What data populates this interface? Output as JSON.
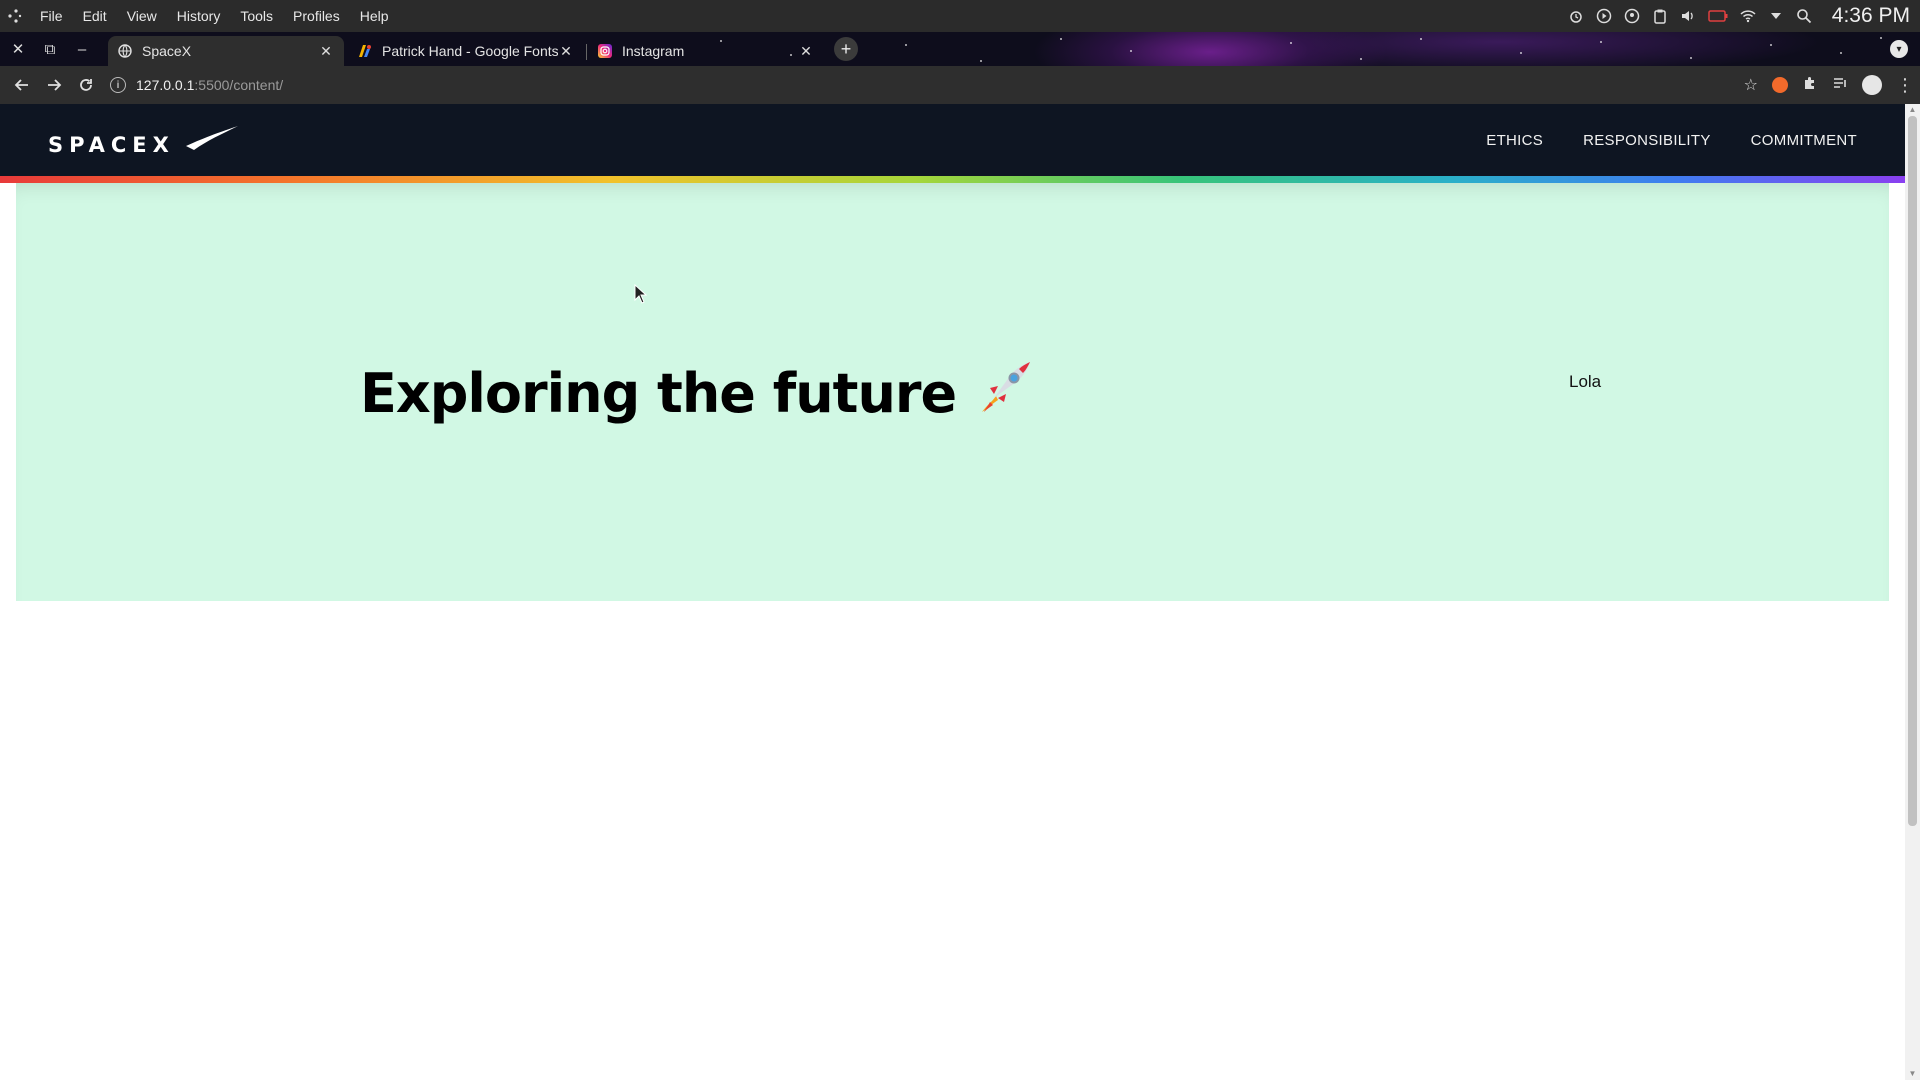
{
  "os_bar": {
    "menu": [
      "File",
      "Edit",
      "View",
      "History",
      "Tools",
      "Profiles",
      "Help"
    ],
    "clock": "4:36 PM",
    "tray_icons": [
      "alarm-icon",
      "play-icon",
      "vpn-icon",
      "clipboard-icon",
      "volume-icon",
      "battery-icon",
      "wifi-icon",
      "dropdown-icon",
      "search-icon"
    ]
  },
  "tabs": [
    {
      "title": "SpaceX",
      "active": true,
      "favicon": "globe-icon"
    },
    {
      "title": "Patrick Hand - Google Fonts",
      "active": false,
      "favicon": "google-fonts-icon"
    },
    {
      "title": "Instagram",
      "active": false,
      "favicon": "instagram-icon"
    }
  ],
  "toolbar": {
    "url_host": "127.0.0.1",
    "url_path": ":5500/content/"
  },
  "site": {
    "logo_text": "SPACEX",
    "nav": [
      "ETHICS",
      "RESPONSIBILITY",
      "COMMITMENT"
    ],
    "hero_title": "Exploring the future",
    "hero_emoji": "🚀",
    "hero_aside": "Lola"
  },
  "colors": {
    "header_bg": "#0e1522",
    "hero_bg": "#d1f8e4",
    "os_bar_bg": "#2b2b2b",
    "toolbar_bg": "#2e2e2e"
  }
}
